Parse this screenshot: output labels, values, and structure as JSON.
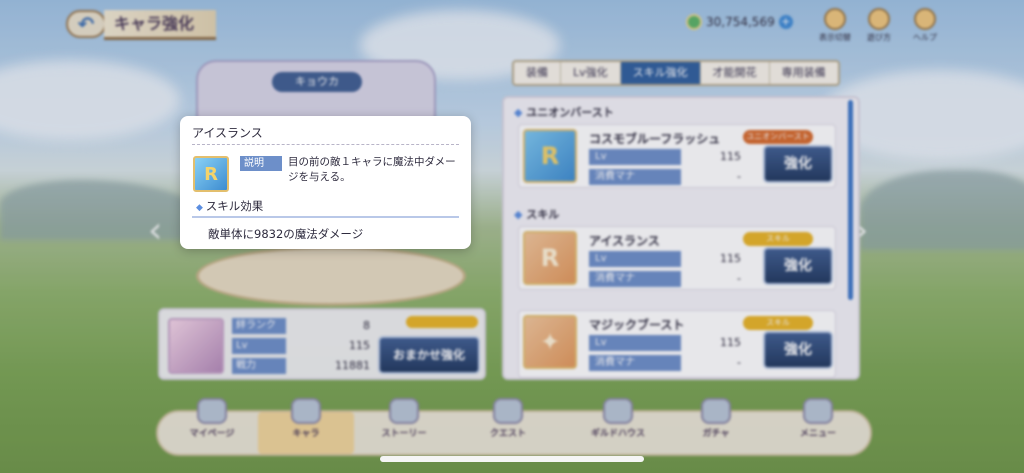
{
  "header": {
    "title": "キャラ強化",
    "mana": "30,754,569",
    "icons": [
      {
        "name": "ranged-icon",
        "label": "表示切替"
      },
      {
        "name": "info-icon",
        "label": "遊び方"
      },
      {
        "name": "help-icon",
        "label": "ヘルプ"
      }
    ]
  },
  "tabs": [
    "装備",
    "Lv強化",
    "スキル強化",
    "才能開花",
    "専用装備"
  ],
  "character": {
    "name": "キョウカ",
    "stats": [
      {
        "label": "絆ランク",
        "value": "8"
      },
      {
        "label": "Lv",
        "value": "115"
      },
      {
        "label": "戦力",
        "value": "11881"
      }
    ],
    "auto_button": "おまかせ強化"
  },
  "skills": {
    "union_header": "ユニオンバースト",
    "skill_header": "スキル",
    "items": [
      {
        "name": "コスモブルーフラッシュ",
        "badge": "ユニオンバースト",
        "lv_label": "Lv",
        "lv": "115",
        "cost_label": "消費マナ",
        "cost": "-",
        "button": "強化",
        "icon": "cosmo-blue-flash-icon"
      },
      {
        "name": "アイスランス",
        "badge": "スキル",
        "lv_label": "Lv",
        "lv": "115",
        "cost_label": "消費マナ",
        "cost": "-",
        "button": "強化",
        "icon": "ice-lance-icon"
      },
      {
        "name": "マジックブースト",
        "badge": "スキル",
        "lv_label": "Lv",
        "lv": "115",
        "cost_label": "消費マナ",
        "cost": "-",
        "button": "強化",
        "icon": "magic-boost-icon"
      }
    ]
  },
  "popup": {
    "title": "アイスランス",
    "desc_label": "説明",
    "desc": "目の前の敵１キャラに魔法中ダメージを与える。",
    "effect_header": "スキル効果",
    "effect_value": "敵単体に9832の魔法ダメージ"
  },
  "nav": [
    "マイページ",
    "キャラ",
    "ストーリー",
    "クエスト",
    "ギルドハウス",
    "ガチャ",
    "メニュー"
  ],
  "colors": {
    "accent": "#2f5f9e",
    "label_blue": "#6d8fc9",
    "badge_gold": "#e9b425"
  }
}
